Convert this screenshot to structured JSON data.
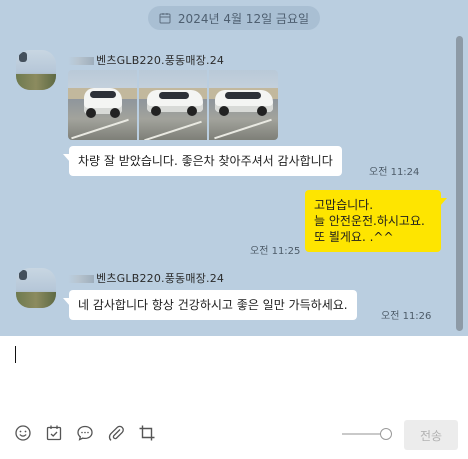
{
  "date_divider": {
    "text": "2024년 4월 12일 금요일",
    "icon": "calendar-icon"
  },
  "messages": [
    {
      "sender": "벤츠GLB220.풍동매장.24",
      "photos": [
        "car-photo-front",
        "car-photo-side",
        "car-photo-rear"
      ],
      "text": "차량 잘 받았습니다.  좋은차 찾아주셔서 감사합니다",
      "time": "오전 11:24"
    },
    {
      "mine": true,
      "text": "고맙습니다.\n늘 안전운전.하시고요.\n또 뵐게요.  .^^",
      "time": "오전 11:25"
    },
    {
      "sender": "벤츠GLB220.풍동매장.24",
      "text": "네 감사합니다 항상 건강하시고 좋은 일만 가득하세요.",
      "time": "오전 11:26"
    }
  ],
  "composer": {
    "value": "",
    "tools": [
      "emoticon-icon",
      "schedule-icon",
      "chat-bubble-icon",
      "paperclip-icon",
      "crop-icon"
    ],
    "send_label": "전송"
  },
  "colors": {
    "chat_background": "#bacee0",
    "my_bubble": "#fee500",
    "their_bubble": "#ffffff"
  }
}
